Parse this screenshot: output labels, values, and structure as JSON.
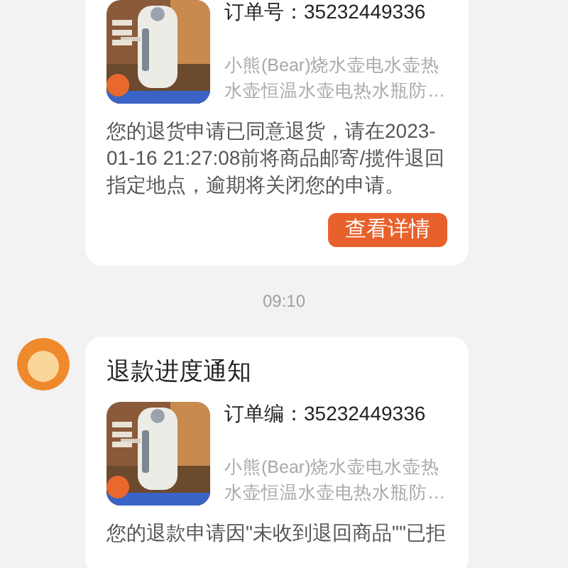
{
  "feed": [
    {
      "kind": "card",
      "order_no": "订单号：35232449336",
      "product_name": "小熊(Bear)烧水壶电水壶热水壶恒温水壶电热水瓶防…",
      "body": "您的退货申请已同意退货，请在2023-01-16 21:27:08前将商品邮寄/揽件退回指定地点，逾期将关闭您的申请。",
      "button": "查看详情"
    },
    {
      "kind": "time",
      "text": "09:10"
    },
    {
      "kind": "card",
      "avatar": true,
      "title": "退款进度通知",
      "order_no": "订单编：35232449336",
      "product_name": "小熊(Bear)烧水壶电水壶热水壶恒温水壶电热水瓶防…",
      "body": "您的退款申请因\"未收到退回商品\"\"已拒"
    }
  ]
}
